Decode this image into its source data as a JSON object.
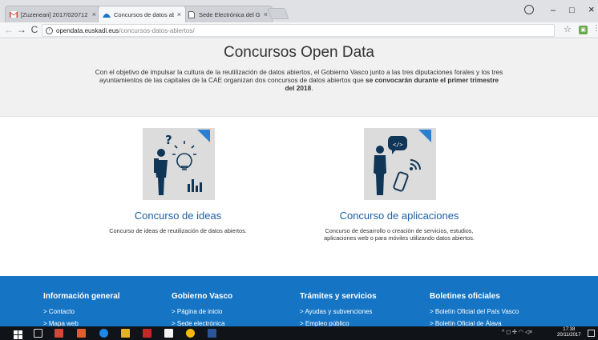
{
  "tabs": [
    {
      "label": "[Zuzenean] 2017/020712",
      "favicon": "gmail-icon",
      "active": false
    },
    {
      "label": "Concursos de datos abie",
      "favicon": "open-data-icon",
      "active": true
    },
    {
      "label": "Sede Electrónica del Gob",
      "favicon": "page-icon",
      "active": false
    }
  ],
  "window": {
    "minimize": "–",
    "maximize": "□",
    "close": "×"
  },
  "address": {
    "domain": "opendata.euskadi.eus",
    "path": "/concursos-datos-abiertos/"
  },
  "hero": {
    "title": "Concursos Open Data",
    "intro": "Con el objetivo de impulsar la cultura de la reutilización de datos abiertos, el Gobierno Vasco junto a las tres diputaciones forales y los tres ayuntamientos de las capitales de la CAE organizan dos concursos de datos abiertos que ",
    "intro_bold": "se convocarán durante el primer trimestre del 2018",
    "intro_end": "."
  },
  "cards": [
    {
      "title": "Concurso de ideas",
      "description": "Concurso de ideas de reutilización de datos abiertos."
    },
    {
      "title": "Concurso de aplicaciones",
      "description": "Concurso de desarrollo o creación de servicios, estudios, aplicaciones web o para móviles utilizando datos abiertos."
    }
  ],
  "footer": [
    {
      "heading": "Información general",
      "links": [
        "> Contacto",
        "> Mapa web"
      ]
    },
    {
      "heading": "Gobierno Vasco",
      "links": [
        "> Página de inicio",
        "> Sede electrónica"
      ]
    },
    {
      "heading": "Trámites y servicios",
      "links": [
        "> Ayudas y subvenciones",
        "> Empleo público"
      ]
    },
    {
      "heading": "Boletines oficiales",
      "links": [
        "> Boletín Oficial del País Vasco",
        "> Boletín Oficial de Álava"
      ]
    }
  ],
  "taskbar": {
    "time": "17:38",
    "date": "20/11/2017"
  },
  "colors": {
    "footer_bg": "#1575c4",
    "link": "#1d5fa3",
    "hero_bg": "#f1f1f1"
  }
}
